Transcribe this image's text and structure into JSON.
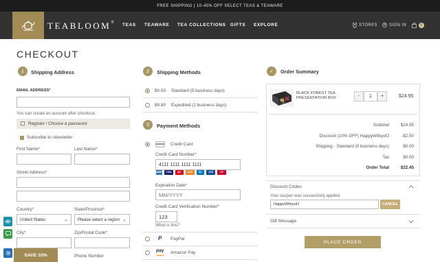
{
  "promo": {
    "text": "FREE SHIPPING | 10-45% OFF SELECT TEAS & TEAWARE"
  },
  "nav": {
    "brand": "TEABLOOM",
    "brand_mark": "®",
    "links": [
      "TEAS",
      "TEAWARE",
      "TEA COLLECTIONS",
      "GIFTS",
      "EXPLORE"
    ],
    "stores": "STORES",
    "signin": "SIGN IN",
    "cart_count": "0"
  },
  "page": {
    "title": "CHECKOUT"
  },
  "shipping_address": {
    "step": "1",
    "title": "Shipping Address",
    "email_label": "EMAIL ADDRESS",
    "email_value": "",
    "account_hint": "You can create an account after checkout.",
    "register_label": "Register / Choose a password",
    "newsletter_label": "Subscribe to newsletter",
    "first_name_label": "First Name",
    "last_name_label": "Last Name",
    "street_label": "Street Address",
    "country_label": "Country",
    "country_value": "United States",
    "state_label": "State/Province",
    "state_value": "Please select a region",
    "city_label": "City",
    "zip_label": "Zip/Postal Code",
    "phone_label": "Phone Number",
    "required_mark": "*"
  },
  "shipping_methods": {
    "step": "2",
    "title": "Shipping Methods",
    "options": [
      {
        "price": "$0.00",
        "name": "Standard (5 business days)"
      },
      {
        "price": "$9.80",
        "name": "Expedited (2 business days)"
      }
    ]
  },
  "payment_methods": {
    "step": "3",
    "title": "Payment Methods",
    "credit_card_label": "Credit Card",
    "card_number_label": "Credit Card Number",
    "card_number_value": "4111 1111 1111 1111",
    "expiration_label": "Expiration Date",
    "expiration_placeholder": "MM/YYYY",
    "cvv_label": "Credit Card Verification Number",
    "cvv_value": "123",
    "what_is_this": "What is this?",
    "paypal_label": "PayPal",
    "paypal_logo": "P",
    "amazon_label": "Amazon Pay",
    "amazon_logo": "pay",
    "card_brands": [
      {
        "name": "AMEX",
        "color": "#2e77bb"
      },
      {
        "name": "VISA",
        "color": "#1a1f71"
      },
      {
        "name": "MC",
        "color": "#eb001b"
      },
      {
        "name": "DISC",
        "color": "#f58220"
      },
      {
        "name": "DC",
        "color": "#0079be"
      },
      {
        "name": "JCB",
        "color": "#0e4c96"
      },
      {
        "name": "UP",
        "color": "#d10429"
      }
    ]
  },
  "order_summary": {
    "step": "✓",
    "title": "Order Summary",
    "product_name": "BLACK FOREST TEA PRESENTATION BOX",
    "qty": "1",
    "qty_minus": "-",
    "qty_plus": "+",
    "line_price": "$24.95",
    "rows": [
      {
        "label": "Subtotal",
        "value": "$24.95"
      },
      {
        "label": "Discount (10% OFF) HappyWifeyofJ",
        "value": "-$2.50"
      },
      {
        "label": "Shipping - Standard (5 business days)",
        "value": "$0.00"
      },
      {
        "label": "Tax",
        "value": "$0.00"
      },
      {
        "label": "Order Total",
        "value": "$22.45"
      }
    ]
  },
  "discount": {
    "title": "Discount Codes",
    "success": "Your coupon was successfully applied.",
    "code": "HappyWifeyofJ",
    "cancel": "CANCEL"
  },
  "gift": {
    "title": "Gift Message"
  },
  "place_order": "PLACE ORDER",
  "save_tab": "SAVE 10%",
  "colors": {
    "gold": "#a99665",
    "nav": "#323232",
    "promo": "#1c1c1c"
  }
}
